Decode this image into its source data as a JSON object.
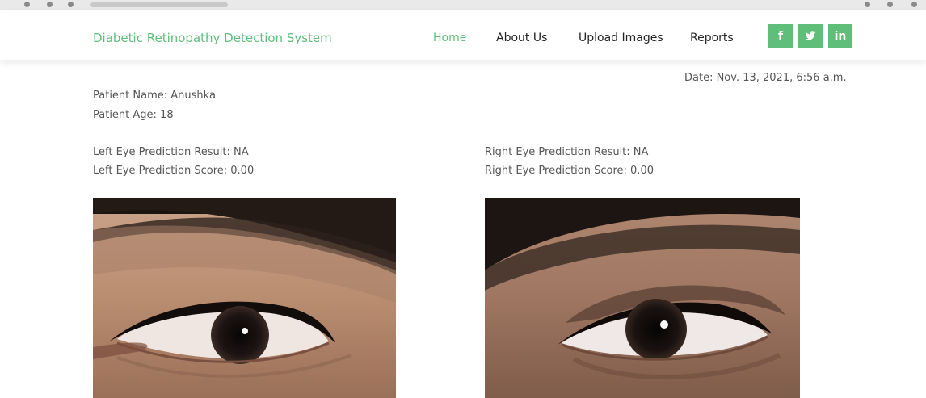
{
  "nav": {
    "brand": "Diabetic Retinopathy Detection System",
    "links": [
      "Home",
      "About Us",
      "Upload Images",
      "Reports"
    ],
    "social": [
      "f",
      "y",
      "in"
    ]
  },
  "report": {
    "date": "Date: Nov. 13, 2021, 6:56 a.m.",
    "patient_name": "Patient Name: Anushka",
    "patient_age": "Patient Age: 18",
    "left_result": "Left Eye Prediction Result: NA",
    "left_score": "Left Eye Prediction Score: 0.00",
    "right_result": "Right Eye Prediction Result: NA",
    "right_score": "Right Eye Prediction Score: 0.00"
  },
  "icons": {
    "social": [
      "facebook-icon",
      "twitter-icon",
      "linkedin-icon"
    ]
  },
  "colors": {
    "accent": "#5fbf7a"
  }
}
